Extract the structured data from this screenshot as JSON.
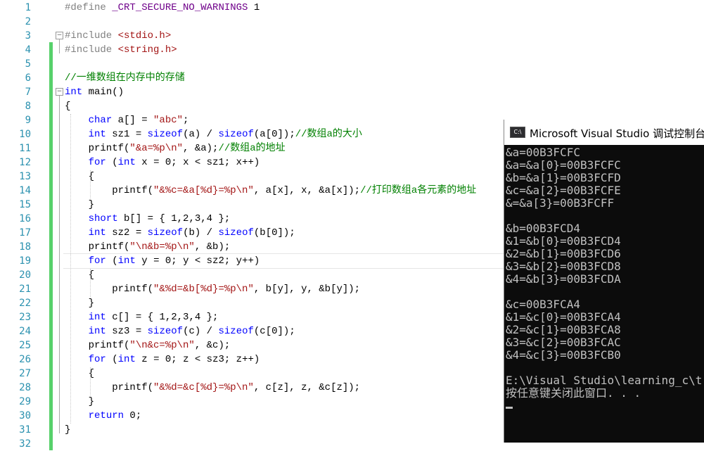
{
  "editor": {
    "line_numbers": [
      "1",
      "2",
      "3",
      "4",
      "5",
      "6",
      "7",
      "8",
      "9",
      "10",
      "11",
      "12",
      "13",
      "14",
      "15",
      "16",
      "17",
      "18",
      "19",
      "20",
      "21",
      "22",
      "23",
      "24",
      "25",
      "26",
      "27",
      "28",
      "29",
      "30",
      "31",
      "32"
    ],
    "lines": [
      [
        {
          "t": "#define ",
          "c": "pp"
        },
        {
          "t": "_CRT_SECURE_NO_WARNINGS",
          "c": "macro"
        },
        {
          "t": " 1",
          "c": ""
        }
      ],
      [],
      [
        {
          "t": "#include ",
          "c": "pp"
        },
        {
          "t": "<stdio.h>",
          "c": "str"
        }
      ],
      [
        {
          "t": "#include ",
          "c": "pp"
        },
        {
          "t": "<string.h>",
          "c": "str"
        }
      ],
      [],
      [
        {
          "t": "//一维数组在内存中的存储",
          "c": "cm"
        }
      ],
      [
        {
          "t": "int",
          "c": "kw"
        },
        {
          "t": " main()",
          "c": ""
        }
      ],
      [
        {
          "t": "{",
          "c": ""
        }
      ],
      [
        {
          "t": "    ",
          "c": ""
        },
        {
          "t": "char",
          "c": "kw"
        },
        {
          "t": " a[] = ",
          "c": ""
        },
        {
          "t": "\"abc\"",
          "c": "str"
        },
        {
          "t": ";",
          "c": ""
        }
      ],
      [
        {
          "t": "    ",
          "c": ""
        },
        {
          "t": "int",
          "c": "kw"
        },
        {
          "t": " sz1 = ",
          "c": ""
        },
        {
          "t": "sizeof",
          "c": "kw"
        },
        {
          "t": "(a) / ",
          "c": ""
        },
        {
          "t": "sizeof",
          "c": "kw"
        },
        {
          "t": "(a[0]);",
          "c": ""
        },
        {
          "t": "//数组a的大小",
          "c": "cm"
        }
      ],
      [
        {
          "t": "    printf(",
          "c": ""
        },
        {
          "t": "\"&a=%p\\n\"",
          "c": "str"
        },
        {
          "t": ", &a);",
          "c": ""
        },
        {
          "t": "//数组a的地址",
          "c": "cm"
        }
      ],
      [
        {
          "t": "    ",
          "c": ""
        },
        {
          "t": "for",
          "c": "kw"
        },
        {
          "t": " (",
          "c": ""
        },
        {
          "t": "int",
          "c": "kw"
        },
        {
          "t": " x = 0; x < sz1; x++)",
          "c": ""
        }
      ],
      [
        {
          "t": "    {",
          "c": ""
        }
      ],
      [
        {
          "t": "        printf(",
          "c": ""
        },
        {
          "t": "\"&%c=&a[%d}=%p\\n\"",
          "c": "str"
        },
        {
          "t": ", a[x], x, &a[x]);",
          "c": ""
        },
        {
          "t": "//打印数组a各元素的地址",
          "c": "cm"
        }
      ],
      [
        {
          "t": "    }",
          "c": ""
        }
      ],
      [
        {
          "t": "    ",
          "c": ""
        },
        {
          "t": "short",
          "c": "kw"
        },
        {
          "t": " b[] = { 1,2,3,4 };",
          "c": ""
        }
      ],
      [
        {
          "t": "    ",
          "c": ""
        },
        {
          "t": "int",
          "c": "kw"
        },
        {
          "t": " sz2 = ",
          "c": ""
        },
        {
          "t": "sizeof",
          "c": "kw"
        },
        {
          "t": "(b) / ",
          "c": ""
        },
        {
          "t": "sizeof",
          "c": "kw"
        },
        {
          "t": "(b[0]);",
          "c": ""
        }
      ],
      [
        {
          "t": "    printf(",
          "c": ""
        },
        {
          "t": "\"\\n&b=%p\\n\"",
          "c": "str"
        },
        {
          "t": ", &b);",
          "c": ""
        }
      ],
      [
        {
          "t": "    ",
          "c": ""
        },
        {
          "t": "for",
          "c": "kw"
        },
        {
          "t": " (",
          "c": ""
        },
        {
          "t": "int",
          "c": "kw"
        },
        {
          "t": " y = 0; y < sz2; y++)",
          "c": ""
        }
      ],
      [
        {
          "t": "    {",
          "c": ""
        }
      ],
      [
        {
          "t": "        printf(",
          "c": ""
        },
        {
          "t": "\"&%d=&b[%d}=%p\\n\"",
          "c": "str"
        },
        {
          "t": ", b[y], y, &b[y]);",
          "c": ""
        }
      ],
      [
        {
          "t": "    }",
          "c": ""
        }
      ],
      [
        {
          "t": "    ",
          "c": ""
        },
        {
          "t": "int",
          "c": "kw"
        },
        {
          "t": " c[] = { 1,2,3,4 };",
          "c": ""
        }
      ],
      [
        {
          "t": "    ",
          "c": ""
        },
        {
          "t": "int",
          "c": "kw"
        },
        {
          "t": " sz3 = ",
          "c": ""
        },
        {
          "t": "sizeof",
          "c": "kw"
        },
        {
          "t": "(c) / ",
          "c": ""
        },
        {
          "t": "sizeof",
          "c": "kw"
        },
        {
          "t": "(c[0]);",
          "c": ""
        }
      ],
      [
        {
          "t": "    printf(",
          "c": ""
        },
        {
          "t": "\"\\n&c=%p\\n\"",
          "c": "str"
        },
        {
          "t": ", &c);",
          "c": ""
        }
      ],
      [
        {
          "t": "    ",
          "c": ""
        },
        {
          "t": "for",
          "c": "kw"
        },
        {
          "t": " (",
          "c": ""
        },
        {
          "t": "int",
          "c": "kw"
        },
        {
          "t": " z = 0; z < sz3; z++)",
          "c": ""
        }
      ],
      [
        {
          "t": "    {",
          "c": ""
        }
      ],
      [
        {
          "t": "        printf(",
          "c": ""
        },
        {
          "t": "\"&%d=&c[%d}=%p\\n\"",
          "c": "str"
        },
        {
          "t": ", c[z], z, &c[z]);",
          "c": ""
        }
      ],
      [
        {
          "t": "    }",
          "c": ""
        }
      ],
      [
        {
          "t": "    ",
          "c": ""
        },
        {
          "t": "return",
          "c": "kw"
        },
        {
          "t": " 0;",
          "c": ""
        }
      ],
      [
        {
          "t": "}",
          "c": ""
        }
      ],
      []
    ],
    "fold_markers": [
      "−",
      "−",
      "−"
    ],
    "colors": {
      "line_number": "#2b91af",
      "keyword": "#0000ff",
      "string": "#a31515",
      "comment": "#008000",
      "preprocessor": "#808080",
      "macro": "#6f008a",
      "change_bar": "#57d16b"
    }
  },
  "console": {
    "title": "Microsoft Visual Studio 调试控制台",
    "icon_label": "C:\\",
    "lines": [
      "&a=00B3FCFC",
      "&a=&a[0}=00B3FCFC",
      "&b=&a[1}=00B3FCFD",
      "&c=&a[2}=00B3FCFE",
      "&=&a[3}=00B3FCFF",
      "",
      "&b=00B3FCD4",
      "&1=&b[0}=00B3FCD4",
      "&2=&b[1}=00B3FCD6",
      "&3=&b[2}=00B3FCD8",
      "&4=&b[3}=00B3FCDA",
      "",
      "&c=00B3FCA4",
      "&1=&c[0}=00B3FCA4",
      "&2=&c[1}=00B3FCA8",
      "&3=&c[2}=00B3FCAC",
      "&4=&c[3}=00B3FCB0",
      "",
      "E:\\Visual Studio\\learning_c\\t",
      "按任意键关闭此窗口. . ."
    ],
    "colors": {
      "background": "#0c0c0c",
      "text": "#c0c0c0"
    }
  }
}
